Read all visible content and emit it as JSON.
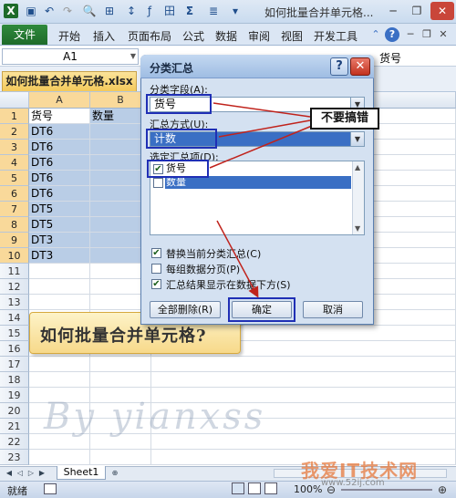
{
  "window": {
    "title": "如何批量合并单元格...",
    "controls": [
      "minimize-icon",
      "restore-icon",
      "close-icon"
    ]
  },
  "ribbon": {
    "file_tab": "文件",
    "tabs": [
      "开始",
      "插入",
      "页面布局",
      "公式",
      "数据",
      "审阅",
      "视图",
      "开发工具"
    ]
  },
  "formula_bar": {
    "name_box": "A1",
    "content": "货号"
  },
  "workbook_tab": "如何批量合并单元格.xlsx",
  "sheet": {
    "columns": [
      "A",
      "B"
    ],
    "rows": [
      "1",
      "2",
      "3",
      "4",
      "5",
      "6",
      "7",
      "8",
      "9",
      "10",
      "11",
      "12",
      "13",
      "14",
      "15",
      "16",
      "17",
      "18",
      "19",
      "20",
      "21",
      "22",
      "23"
    ],
    "data": [
      [
        "货号",
        "数量"
      ],
      [
        "DT6",
        ""
      ],
      [
        "DT6",
        ""
      ],
      [
        "DT6",
        ""
      ],
      [
        "DT6",
        ""
      ],
      [
        "DT6",
        ""
      ],
      [
        "DT5",
        ""
      ],
      [
        "DT5",
        ""
      ],
      [
        "DT3",
        ""
      ],
      [
        "DT3",
        ""
      ]
    ],
    "tab_name": "Sheet1"
  },
  "callout_text": "如何批量合并单元格?",
  "watermark_text": "By yianxss",
  "dialog": {
    "title": "分类汇总",
    "field_label": "分类字段(A):",
    "field_value": "货号",
    "method_label": "汇总方式(U):",
    "method_value": "计数",
    "items_label": "选定汇总项(D):",
    "items": [
      {
        "label": "货号",
        "checked": true
      },
      {
        "label": "数量",
        "checked": false
      }
    ],
    "options": [
      {
        "label": "替换当前分类汇总(C)",
        "checked": true
      },
      {
        "label": "每组数据分页(P)",
        "checked": false
      },
      {
        "label": "汇总结果显示在数据下方(S)",
        "checked": true
      }
    ],
    "buttons": {
      "remove_all": "全部删除(R)",
      "ok": "确定",
      "cancel": "取消"
    }
  },
  "annotation": "不要搞错",
  "status": {
    "ready": "就绪",
    "zoom": "100%"
  },
  "brand": {
    "mark": "我爱IT技术网",
    "url": "www.52ij.com"
  },
  "colors": {
    "excel_green": "#1e6b2a",
    "highlight_blue": "#1f2fb5",
    "annotation_red": "#c0231c"
  }
}
